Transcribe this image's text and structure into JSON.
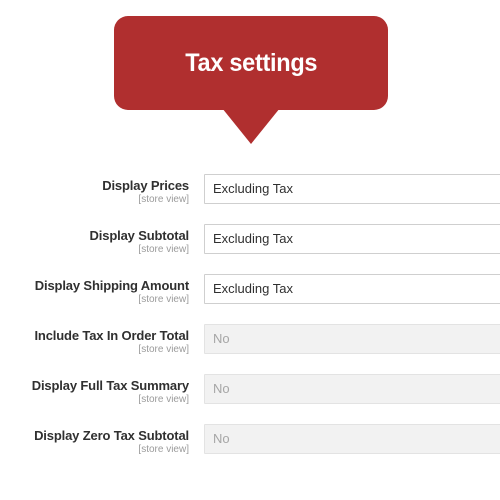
{
  "callout": {
    "title": "Tax settings",
    "background_color": "#b02f2f",
    "text_color": "#ffffff"
  },
  "form": {
    "scope_label": "[store view]",
    "rows": [
      {
        "label": "Display Prices",
        "scope": "[store view]",
        "value": "Excluding Tax",
        "disabled": false
      },
      {
        "label": "Display Subtotal",
        "scope": "[store view]",
        "value": "Excluding Tax",
        "disabled": false
      },
      {
        "label": "Display Shipping Amount",
        "scope": "[store view]",
        "value": "Excluding Tax",
        "disabled": false
      },
      {
        "label": "Include Tax In Order Total",
        "scope": "[store view]",
        "value": "No",
        "disabled": true
      },
      {
        "label": "Display Full Tax Summary",
        "scope": "[store view]",
        "value": "No",
        "disabled": true
      },
      {
        "label": "Display Zero Tax Subtotal",
        "scope": "[store view]",
        "value": "No",
        "disabled": true
      }
    ]
  }
}
